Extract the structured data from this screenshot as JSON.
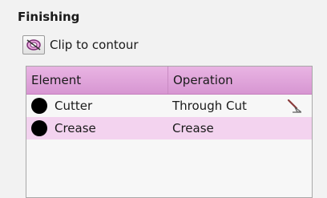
{
  "section": {
    "title": "Finishing"
  },
  "clip": {
    "label": "Clip to contour",
    "icon": "clip-contour-icon"
  },
  "table": {
    "headers": {
      "element": "Element",
      "operation": "Operation"
    },
    "rows": [
      {
        "element": "Cutter",
        "operation": "Through Cut",
        "color": "#000000",
        "tool_icon": "cutter-knife-icon"
      },
      {
        "element": "Crease",
        "operation": "Crease",
        "color": "#000000"
      }
    ],
    "header_color": "#d99bd3",
    "selected_row_color": "#f3d3ef"
  }
}
